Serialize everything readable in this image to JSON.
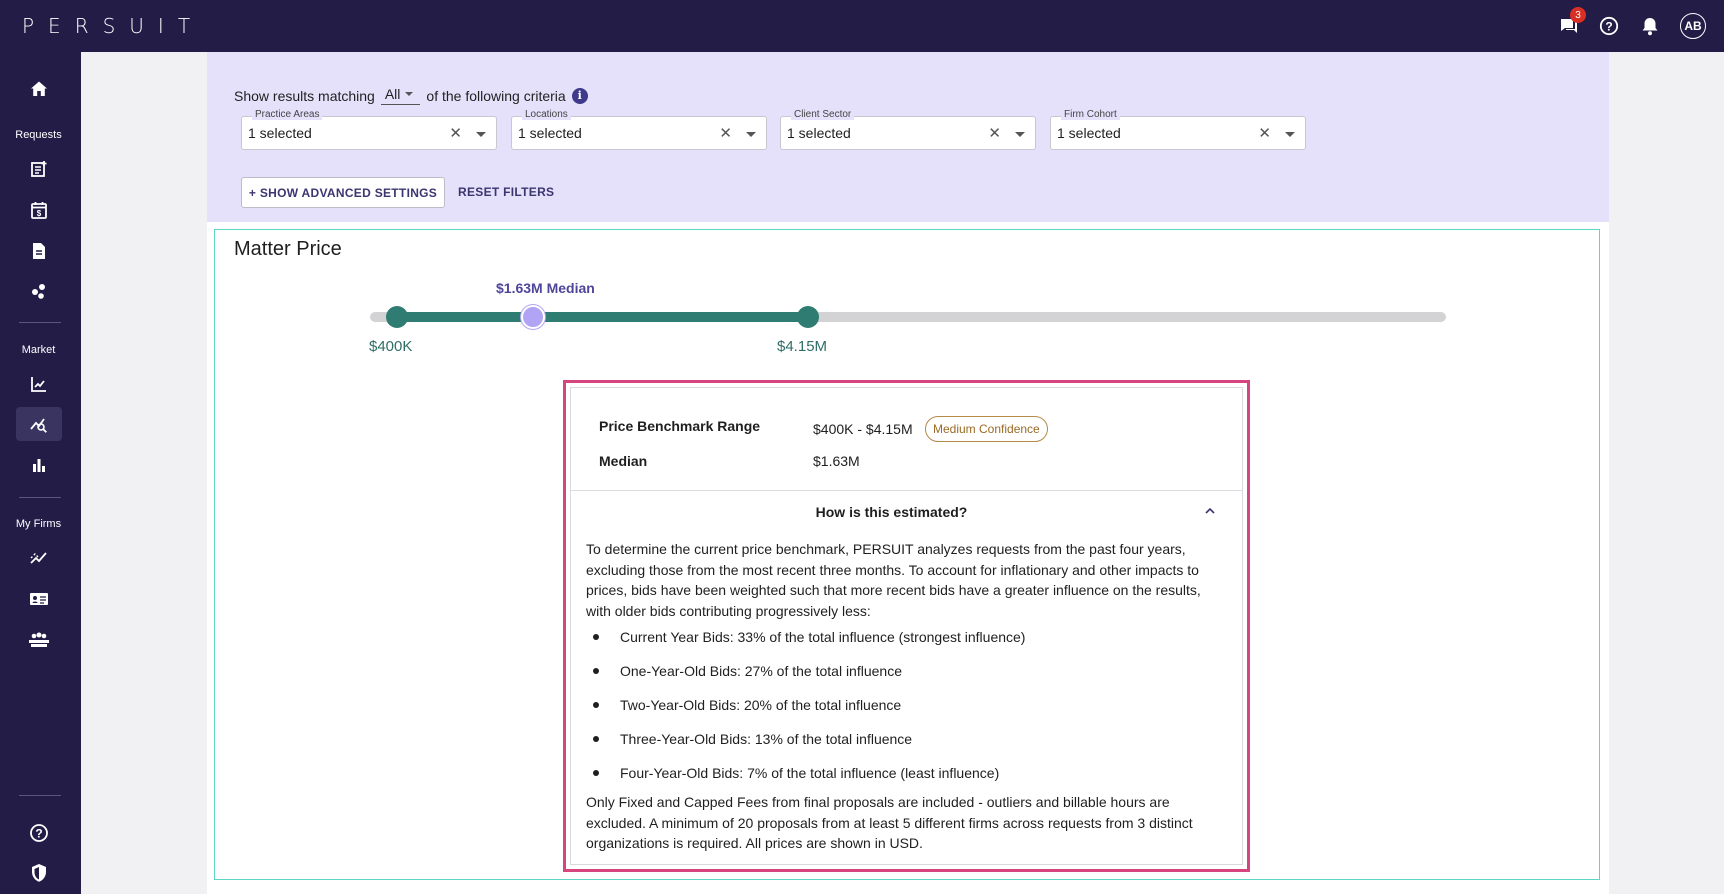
{
  "app": {
    "logo_text": "PERSUIT"
  },
  "topbar": {
    "messages_badge": "3",
    "avatar_initials": "AB",
    "icons": [
      "chat-icon",
      "help-icon",
      "bell-icon"
    ]
  },
  "sidebar": {
    "sections": {
      "requests": "Requests",
      "market": "Market",
      "my_firms": "My Firms"
    },
    "icons": [
      "home-icon",
      "new-request-icon",
      "calendar-dollar-icon",
      "document-icon",
      "scatter-icon",
      "chart-line-icon",
      "price-benchmark-icon",
      "bar-chart-icon",
      "trend-icon",
      "firm-card-icon",
      "firm-group-icon",
      "help-icon",
      "shield-icon"
    ],
    "active": "price-benchmark-icon"
  },
  "filters": {
    "criteria_prefix": "Show results matching",
    "criteria_value": "All",
    "criteria_suffix": "of the following criteria",
    "boxes": [
      {
        "label": "Practice Areas",
        "value": "1 selected"
      },
      {
        "label": "Locations",
        "value": "1 selected"
      },
      {
        "label": "Client Sector",
        "value": "1 selected"
      },
      {
        "label": "Firm Cohort",
        "value": "1 selected"
      }
    ],
    "advanced_button": "+ SHOW ADVANCED SETTINGS",
    "reset_button": "RESET FILTERS"
  },
  "matter_price": {
    "title": "Matter Price",
    "slider": {
      "low_label": "$400K",
      "high_label": "$4.15M",
      "median_label": "$1.63M Median"
    },
    "estimate": {
      "range_label": "Price Benchmark Range",
      "range_value": "$400K - $4.15M",
      "confidence": "Medium Confidence",
      "median_label": "Median",
      "median_value": "$1.63M",
      "how_title": "How is this estimated?",
      "intro": "To determine the current price benchmark, PERSUIT analyzes requests from the past four years, excluding those from the most recent three months. To account for inflationary and other impacts to prices, bids have been weighted such that more recent bids have a greater influence on the results, with older bids contributing progressively less:",
      "bullets": [
        "Current Year Bids: 33% of the total influence (strongest influence)",
        "One-Year-Old Bids: 27% of the total influence",
        "Two-Year-Old Bids: 20% of the total influence",
        "Three-Year-Old Bids: 13% of the total influence",
        "Four-Year-Old Bids: 7% of the total influence (least influence)"
      ],
      "outro": "Only Fixed and Capped Fees from final proposals are included - outliers and billable hours are excluded. A minimum of 20 proposals from at least 5 different firms across requests from 3 distinct organizations is required. All prices are shown in USD."
    }
  },
  "colors": {
    "nav_bg": "#221c46",
    "filter_bg": "#e5e1fb",
    "slider_fill": "#2f7d72",
    "median_thumb": "#b2a4f4",
    "highlight_border": "#d6457d",
    "card_border": "#5fd6c4"
  }
}
